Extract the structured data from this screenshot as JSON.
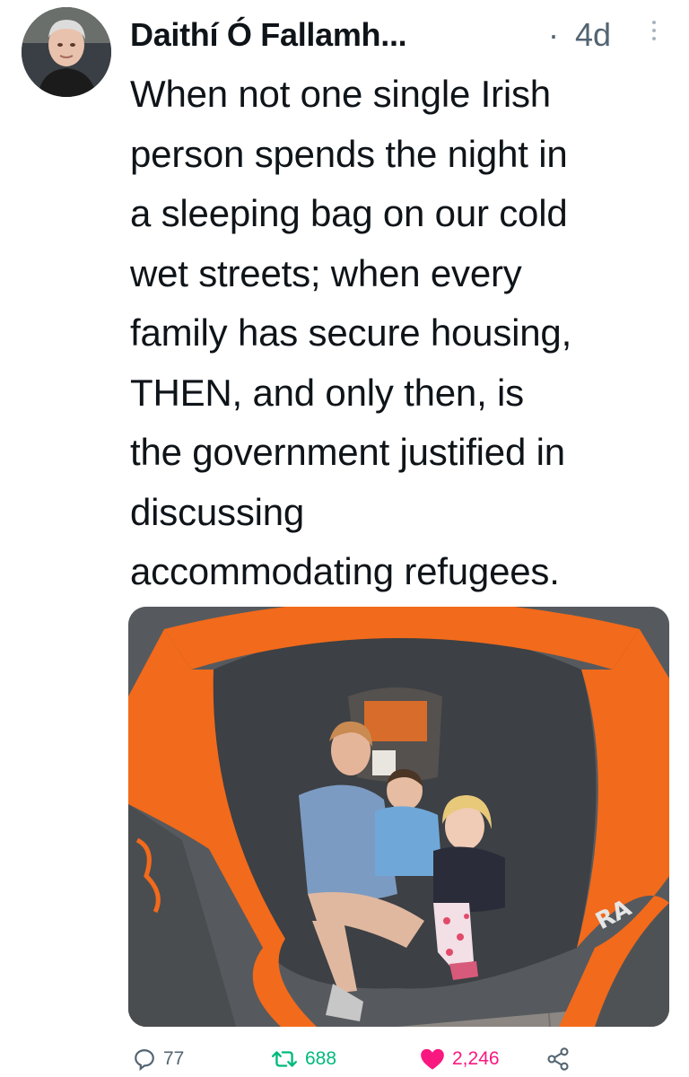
{
  "tweet": {
    "author_name": "Daithí Ó Fallamh...",
    "separator": "·",
    "time": "4d",
    "text_lines": [
      "When not one single Irish",
      "person spends the night in",
      "a sleeping bag on our cold",
      "wet streets; when every",
      "family has secure housing,",
      "THEN, and only then, is",
      "the government justified in",
      "discussing",
      "accommodating refugees."
    ]
  },
  "actions": {
    "replies": "77",
    "retweets": "688",
    "likes": "2,246"
  },
  "icons": {
    "reply": "reply-icon",
    "retweet": "retweet-icon",
    "like": "heart-icon",
    "share": "share-icon",
    "more": "more-icon"
  },
  "colors": {
    "text": "#0f1419",
    "muted": "#536471",
    "retweet": "#00ba7c",
    "like": "#f91880",
    "tent_orange": "#f26a1b"
  }
}
